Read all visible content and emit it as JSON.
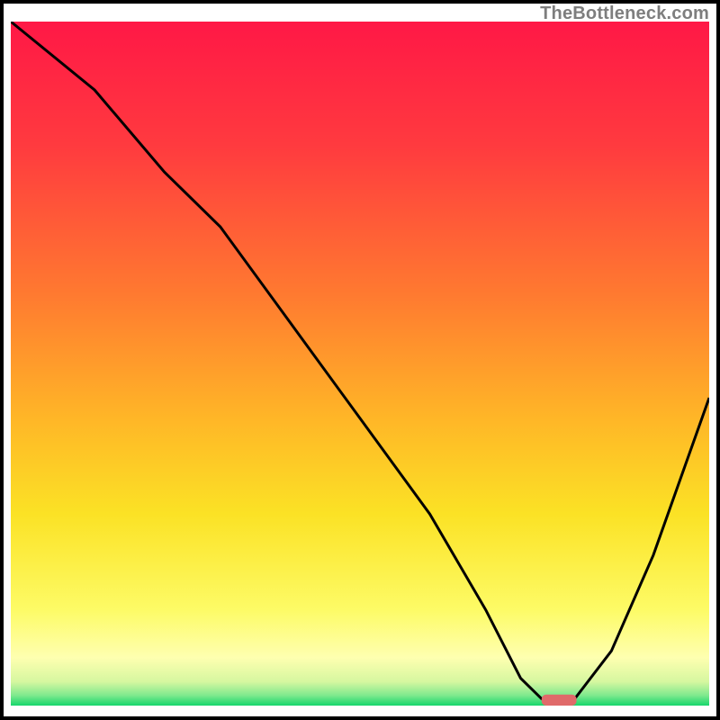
{
  "watermark": "TheBottleneck.com",
  "chart_data": {
    "type": "line",
    "title": "",
    "xlabel": "",
    "ylabel": "",
    "xlim": [
      0,
      100
    ],
    "ylim": [
      0,
      100
    ],
    "legend": null,
    "annotations": [],
    "background_gradient_stops": [
      {
        "offset": 0.0,
        "color": "#ff1846"
      },
      {
        "offset": 0.18,
        "color": "#ff3a3f"
      },
      {
        "offset": 0.4,
        "color": "#ff7a30"
      },
      {
        "offset": 0.58,
        "color": "#ffb627"
      },
      {
        "offset": 0.72,
        "color": "#fbe225"
      },
      {
        "offset": 0.86,
        "color": "#fdfb66"
      },
      {
        "offset": 0.93,
        "color": "#feffb0"
      },
      {
        "offset": 0.965,
        "color": "#d6f7a0"
      },
      {
        "offset": 0.985,
        "color": "#7fe98e"
      },
      {
        "offset": 1.0,
        "color": "#16d66b"
      }
    ],
    "series": [
      {
        "name": "bottleneck-curve",
        "x": [
          0,
          12,
          22,
          30,
          40,
          50,
          60,
          68,
          73,
          76,
          80,
          86,
          92,
          100
        ],
        "y": [
          100,
          90,
          78,
          70,
          56,
          42,
          28,
          14,
          4,
          1,
          0,
          8,
          22,
          45
        ]
      }
    ],
    "marker": {
      "name": "optimal-marker",
      "x": 78.5,
      "y": 0,
      "width": 5,
      "height": 1.6,
      "color": "#e06a6a"
    },
    "grid": false
  }
}
